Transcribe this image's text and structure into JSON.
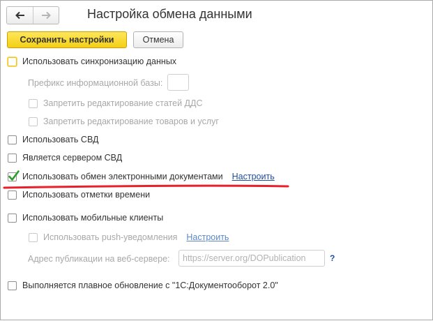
{
  "header": {
    "title": "Настройка обмена данными",
    "back_icon": "arrow-left-icon",
    "forward_icon": "arrow-right-icon"
  },
  "toolbar": {
    "save_label": "Сохранить настройки",
    "cancel_label": "Отмена"
  },
  "settings": {
    "use_sync": {
      "label": "Использовать синхронизацию данных",
      "checked": false
    },
    "base_prefix_label": "Префикс информационной базы:",
    "base_prefix_value": "",
    "forbid_dds": {
      "label": "Запретить редактирование статей ДДС",
      "checked": false
    },
    "forbid_goods": {
      "label": "Запретить редактирование товаров и услуг",
      "checked": false
    },
    "use_svd": {
      "label": "Использовать СВД",
      "checked": false
    },
    "svd_server": {
      "label": "Является сервером СВД",
      "checked": false
    },
    "use_edo": {
      "label": "Использовать обмен электронными документами",
      "checked": true,
      "link": "Настроить"
    },
    "use_timestamps": {
      "label": "Использовать отметки времени",
      "checked": false
    },
    "use_mobile": {
      "label": "Использовать мобильные клиенты",
      "checked": false
    },
    "use_push": {
      "label": "Использовать push-уведомления",
      "checked": false,
      "link": "Настроить"
    },
    "publication_label": "Адрес публикации на веб-сервере:",
    "publication_placeholder": "https://server.org/DOPublication",
    "help_text": "?",
    "smooth_update": {
      "label": "Выполняется плавное обновление с \"1С:Документооборот 2.0\"",
      "checked": false
    }
  },
  "colors": {
    "primary_button": "#f5cf15",
    "link": "#1f4ea1",
    "checkmark": "#2a9d2a",
    "annotation_underline": "#e8202a"
  }
}
